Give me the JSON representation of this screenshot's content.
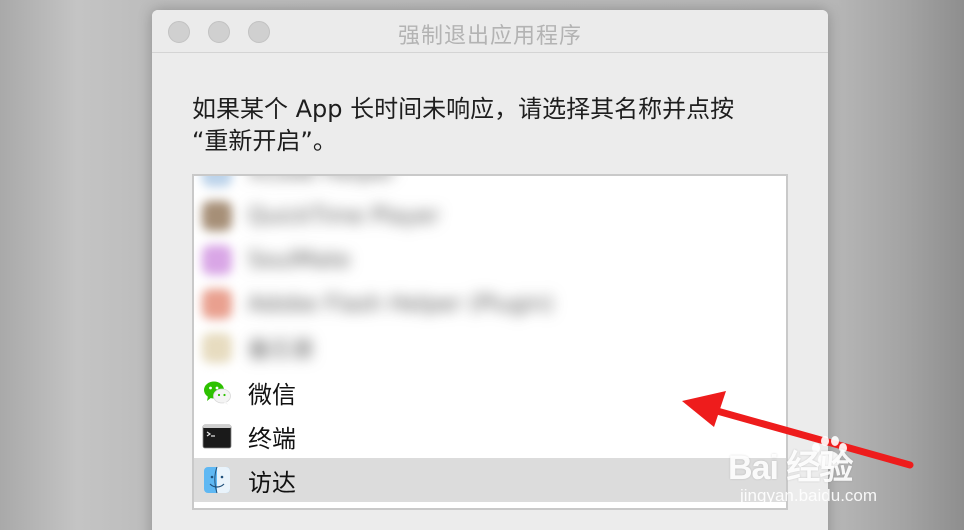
{
  "window": {
    "title": "强制退出应用程序"
  },
  "instruction": {
    "line1": "如果某个 App 长时间未响应，请选择其名称并点按",
    "line2": "“重新开启”。"
  },
  "app_list": {
    "items": [
      {
        "label": "Xcode Helper",
        "icon": "blurred-app-icon"
      },
      {
        "label": "QuickTime Player",
        "icon": "blurred-app-icon"
      },
      {
        "label": "SoulMate",
        "icon": "blurred-app-icon"
      },
      {
        "label": "Adobe Flash Helper (Plugin)",
        "icon": "blurred-app-icon"
      },
      {
        "label": "备忘录",
        "icon": "blurred-app-icon"
      },
      {
        "label": "微信",
        "icon": "wechat-icon"
      },
      {
        "label": "终端",
        "icon": "terminal-icon"
      },
      {
        "label": "访达",
        "icon": "finder-icon",
        "selected": true
      }
    ]
  },
  "watermark": {
    "brand": "Bai  经验",
    "url": "jingyan.baidu.com"
  },
  "colors": {
    "arrow": "#ee1c1c",
    "selection": "#dcdcdc",
    "wechat_green": "#2dc100"
  }
}
